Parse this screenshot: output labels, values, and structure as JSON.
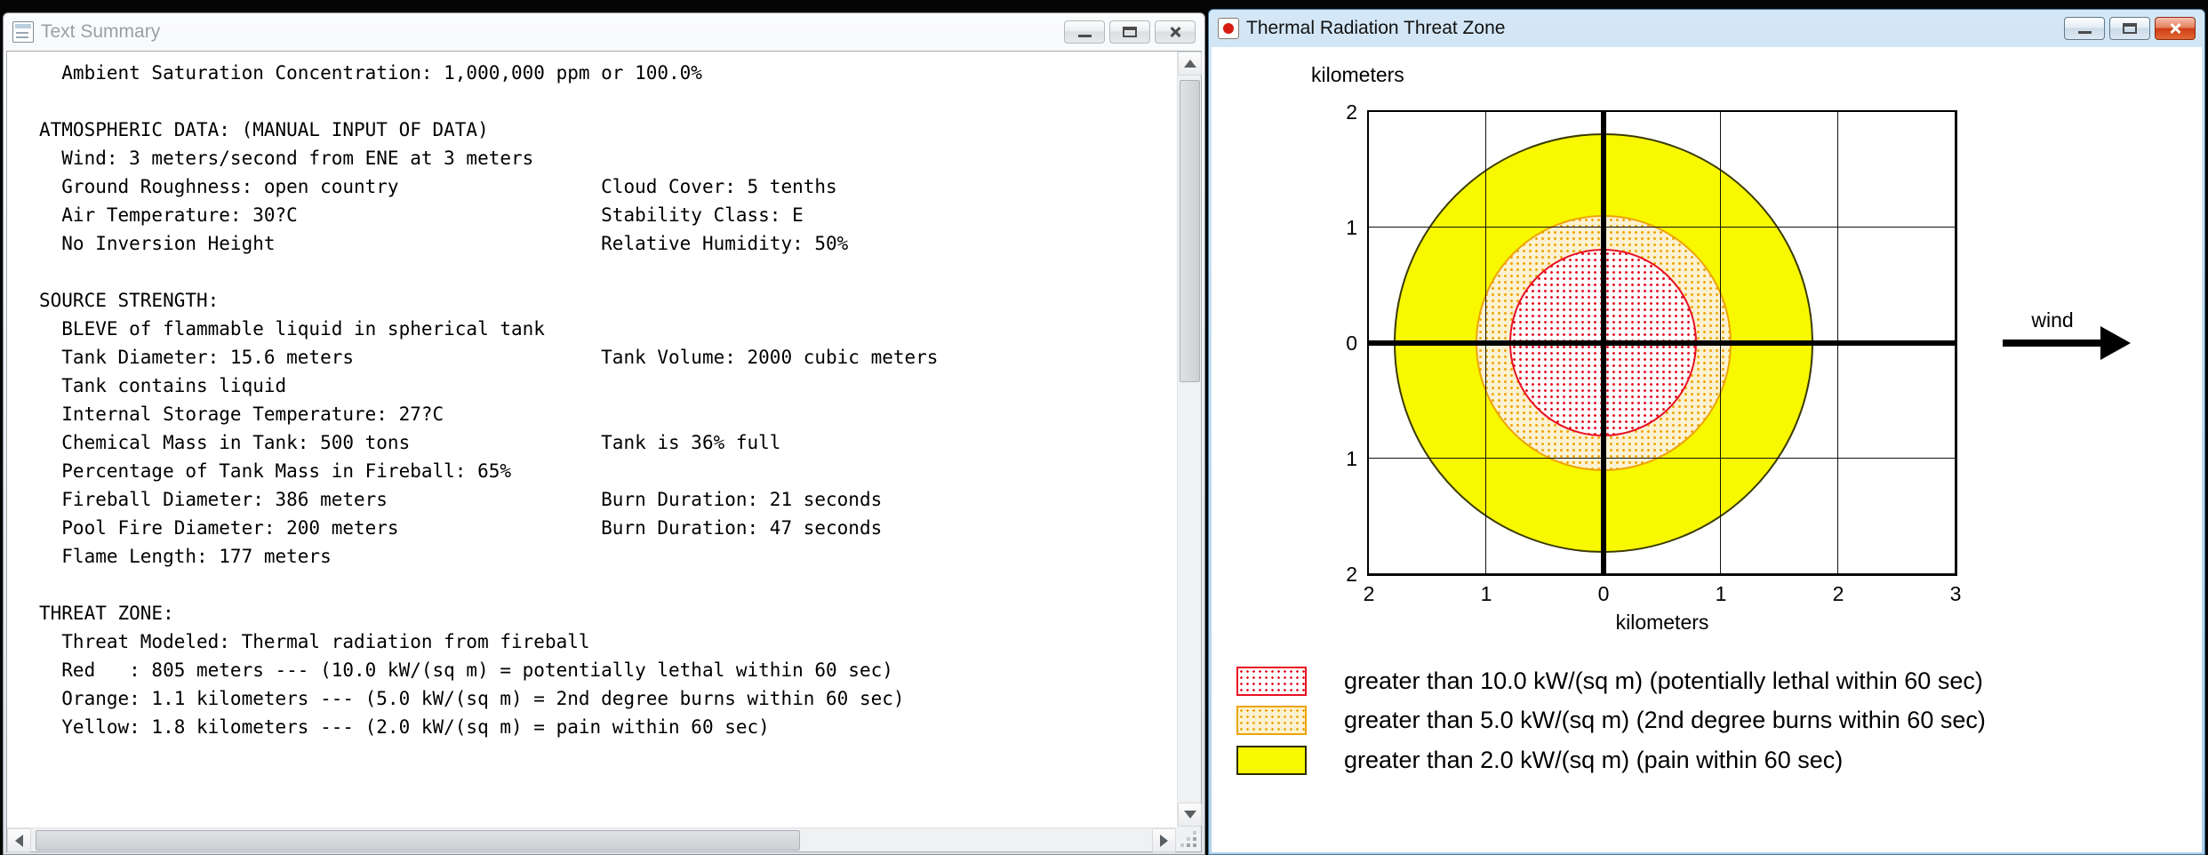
{
  "left_window": {
    "title": "Text Summary",
    "controls": [
      "minimize-icon",
      "maximize-icon",
      "close-icon"
    ],
    "scrollbars": [
      "vertical",
      "horizontal"
    ],
    "lines": [
      "  Ambient Saturation Concentration: 1,000,000 ppm or 100.0%",
      "",
      "ATMOSPHERIC DATA: (MANUAL INPUT OF DATA)",
      "  Wind: 3 meters/second from ENE at 3 meters",
      "  Ground Roughness: open country                  Cloud Cover: 5 tenths",
      "  Air Temperature: 30?C                           Stability Class: E",
      "  No Inversion Height                             Relative Humidity: 50%",
      "",
      "SOURCE STRENGTH:",
      "  BLEVE of flammable liquid in spherical tank",
      "  Tank Diameter: 15.6 meters                      Tank Volume: 2000 cubic meters",
      "  Tank contains liquid",
      "  Internal Storage Temperature: 27?C",
      "  Chemical Mass in Tank: 500 tons                 Tank is 36% full",
      "  Percentage of Tank Mass in Fireball: 65%",
      "  Fireball Diameter: 386 meters                   Burn Duration: 21 seconds",
      "  Pool Fire Diameter: 200 meters                  Burn Duration: 47 seconds",
      "  Flame Length: 177 meters",
      "",
      "THREAT ZONE:",
      "  Threat Modeled: Thermal radiation from fireball",
      "  Red   : 805 meters --- (10.0 kW/(sq m) = potentially lethal within 60 sec)",
      "  Orange: 1.1 kilometers --- (5.0 kW/(sq m) = 2nd degree burns within 60 sec)",
      "  Yellow: 1.8 kilometers --- (2.0 kW/(sq m) = pain within 60 sec)"
    ]
  },
  "right_window": {
    "title": "Thermal Radiation Threat Zone",
    "controls": [
      "minimize-icon",
      "maximize-icon",
      "close-icon"
    ],
    "wind_label": "wind",
    "chart": {
      "y_axis_title": "kilometers",
      "x_axis_title": "kilometers",
      "y_tick_labels": [
        "2",
        "1",
        "0",
        "1",
        "2"
      ],
      "x_tick_labels": [
        "2",
        "1",
        "0",
        "1",
        "2",
        "3"
      ]
    },
    "legend": [
      {
        "zone": "red",
        "text": "greater than 10.0 kW/(sq m) (potentially lethal within 60 sec)"
      },
      {
        "zone": "orange",
        "text": "greater than 5.0 kW/(sq m) (2nd degree burns within 60 sec)"
      },
      {
        "zone": "yellow",
        "text": "greater than 2.0 kW/(sq m) (pain within 60 sec)"
      }
    ],
    "colors": {
      "red": "#e81123",
      "orange": "#eda400",
      "yellow": "#f8f800"
    }
  },
  "chart_data": {
    "type": "area",
    "title": "Thermal Radiation Threat Zone",
    "xlabel": "kilometers",
    "ylabel": "kilometers",
    "xlim": [
      -2,
      3
    ],
    "ylim": [
      -2,
      2
    ],
    "x_ticks": [
      -2,
      -1,
      0,
      1,
      2,
      3
    ],
    "y_ticks": [
      -2,
      -1,
      0,
      1,
      2
    ],
    "grid": true,
    "center": [
      0,
      0
    ],
    "wind_direction": "right",
    "zones": [
      {
        "name": "red",
        "radius_km": 0.805,
        "threshold": "10.0 kW/(sq m)",
        "effect": "potentially lethal within 60 sec",
        "color": "#e81123",
        "fill": "red dot stipple on white"
      },
      {
        "name": "orange",
        "radius_km": 1.1,
        "threshold": "5.0 kW/(sq m)",
        "effect": "2nd degree burns within 60 sec",
        "color": "#eda400",
        "fill": "orange dot stipple on tan"
      },
      {
        "name": "yellow",
        "radius_km": 1.8,
        "threshold": "2.0 kW/(sq m)",
        "effect": "pain within 60 sec",
        "color": "#f8f800",
        "fill": "solid yellow"
      }
    ],
    "legend_position": "bottom-left"
  }
}
